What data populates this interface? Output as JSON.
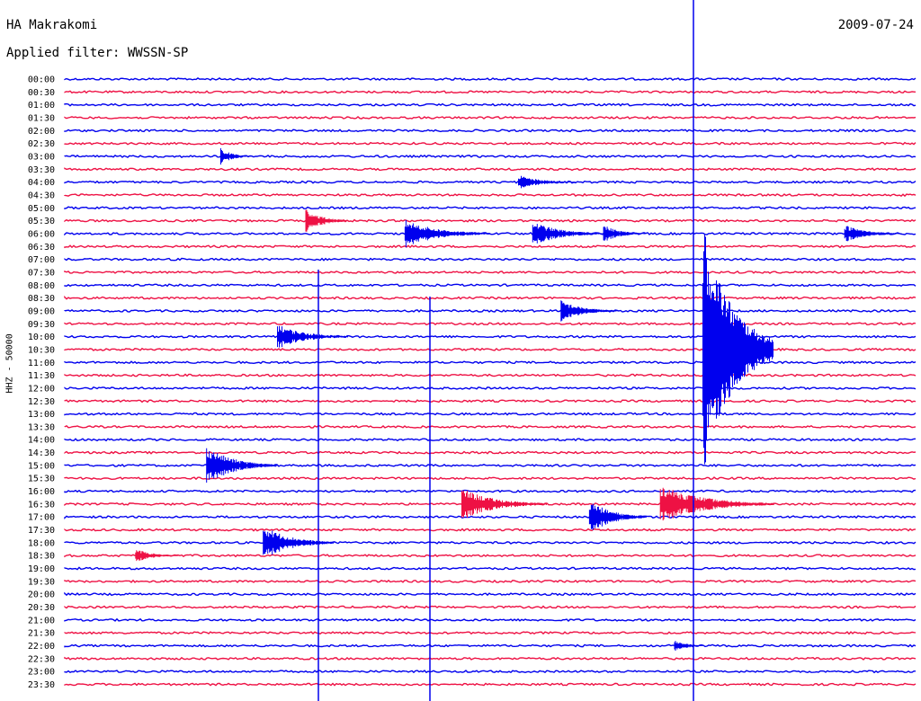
{
  "header": {
    "station": "HA Makrakomi",
    "filter": "Applied filter: WWSSN-SP",
    "date": "2009-07-24"
  },
  "side_label": "HHZ - 50000",
  "colors": {
    "blue": "#0000ee",
    "red": "#ee1144"
  },
  "chart_data": {
    "type": "seismogram",
    "rows": [
      {
        "time": "00:00",
        "color": "blue"
      },
      {
        "time": "00:30",
        "color": "red"
      },
      {
        "time": "01:00",
        "color": "blue"
      },
      {
        "time": "01:30",
        "color": "red"
      },
      {
        "time": "02:00",
        "color": "blue"
      },
      {
        "time": "02:30",
        "color": "red"
      },
      {
        "time": "03:00",
        "color": "blue"
      },
      {
        "time": "03:30",
        "color": "red"
      },
      {
        "time": "04:00",
        "color": "blue"
      },
      {
        "time": "04:30",
        "color": "red"
      },
      {
        "time": "05:00",
        "color": "blue"
      },
      {
        "time": "05:30",
        "color": "red"
      },
      {
        "time": "06:00",
        "color": "blue"
      },
      {
        "time": "06:30",
        "color": "red"
      },
      {
        "time": "07:00",
        "color": "blue"
      },
      {
        "time": "07:30",
        "color": "red"
      },
      {
        "time": "08:00",
        "color": "blue"
      },
      {
        "time": "08:30",
        "color": "red"
      },
      {
        "time": "09:00",
        "color": "blue"
      },
      {
        "time": "09:30",
        "color": "red"
      },
      {
        "time": "10:00",
        "color": "blue"
      },
      {
        "time": "10:30",
        "color": "red"
      },
      {
        "time": "11:00",
        "color": "blue"
      },
      {
        "time": "11:30",
        "color": "red"
      },
      {
        "time": "12:00",
        "color": "blue"
      },
      {
        "time": "12:30",
        "color": "red"
      },
      {
        "time": "13:00",
        "color": "blue"
      },
      {
        "time": "13:30",
        "color": "red"
      },
      {
        "time": "14:00",
        "color": "blue"
      },
      {
        "time": "14:30",
        "color": "red"
      },
      {
        "time": "15:00",
        "color": "blue"
      },
      {
        "time": "15:30",
        "color": "red"
      },
      {
        "time": "16:00",
        "color": "blue"
      },
      {
        "time": "16:30",
        "color": "red"
      },
      {
        "time": "17:00",
        "color": "blue"
      },
      {
        "time": "17:30",
        "color": "red"
      },
      {
        "time": "18:00",
        "color": "blue"
      },
      {
        "time": "18:30",
        "color": "red"
      },
      {
        "time": "19:00",
        "color": "blue"
      },
      {
        "time": "19:30",
        "color": "red"
      },
      {
        "time": "20:00",
        "color": "blue"
      },
      {
        "time": "20:30",
        "color": "red"
      },
      {
        "time": "21:00",
        "color": "blue"
      },
      {
        "time": "21:30",
        "color": "red"
      },
      {
        "time": "22:00",
        "color": "blue"
      },
      {
        "time": "22:30",
        "color": "red"
      },
      {
        "time": "23:00",
        "color": "blue"
      },
      {
        "time": "23:30",
        "color": "red"
      }
    ],
    "events": [
      {
        "row": "03:00",
        "minute": 5.5,
        "amp": 10,
        "dur": 1.0
      },
      {
        "row": "04:00",
        "minute": 16,
        "amp": 8,
        "dur": 2.0
      },
      {
        "row": "05:30",
        "minute": 8.5,
        "amp": 14,
        "dur": 1.5
      },
      {
        "row": "06:00",
        "minute": 12,
        "amp": 16,
        "dur": 3.0
      },
      {
        "row": "06:00",
        "minute": 16.5,
        "amp": 14,
        "dur": 2.5
      },
      {
        "row": "06:00",
        "minute": 19,
        "amp": 10,
        "dur": 1.5
      },
      {
        "row": "06:00",
        "minute": 27.5,
        "amp": 10,
        "dur": 2.0
      },
      {
        "row": "09:00",
        "minute": 17.5,
        "amp": 12,
        "dur": 2.0
      },
      {
        "row": "10:00",
        "minute": 7.5,
        "amp": 14,
        "dur": 2.5
      },
      {
        "row": "15:00",
        "minute": 5,
        "amp": 22,
        "dur": 2.5
      },
      {
        "row": "16:30",
        "minute": 21,
        "amp": 22,
        "dur": 4.0
      },
      {
        "row": "16:30",
        "minute": 14,
        "amp": 18,
        "dur": 3.0
      },
      {
        "row": "17:00",
        "minute": 18.5,
        "amp": 20,
        "dur": 2.0
      },
      {
        "row": "18:00",
        "minute": 7,
        "amp": 20,
        "dur": 2.5
      },
      {
        "row": "18:30",
        "minute": 2.5,
        "amp": 8,
        "dur": 1.5
      },
      {
        "row": "22:00",
        "minute": 21.5,
        "amp": 8,
        "dur": 1.0
      }
    ],
    "main_event": {
      "row": "10:30",
      "minute": 22.5,
      "amp_peak": 140,
      "dur": 2.5
    }
  }
}
